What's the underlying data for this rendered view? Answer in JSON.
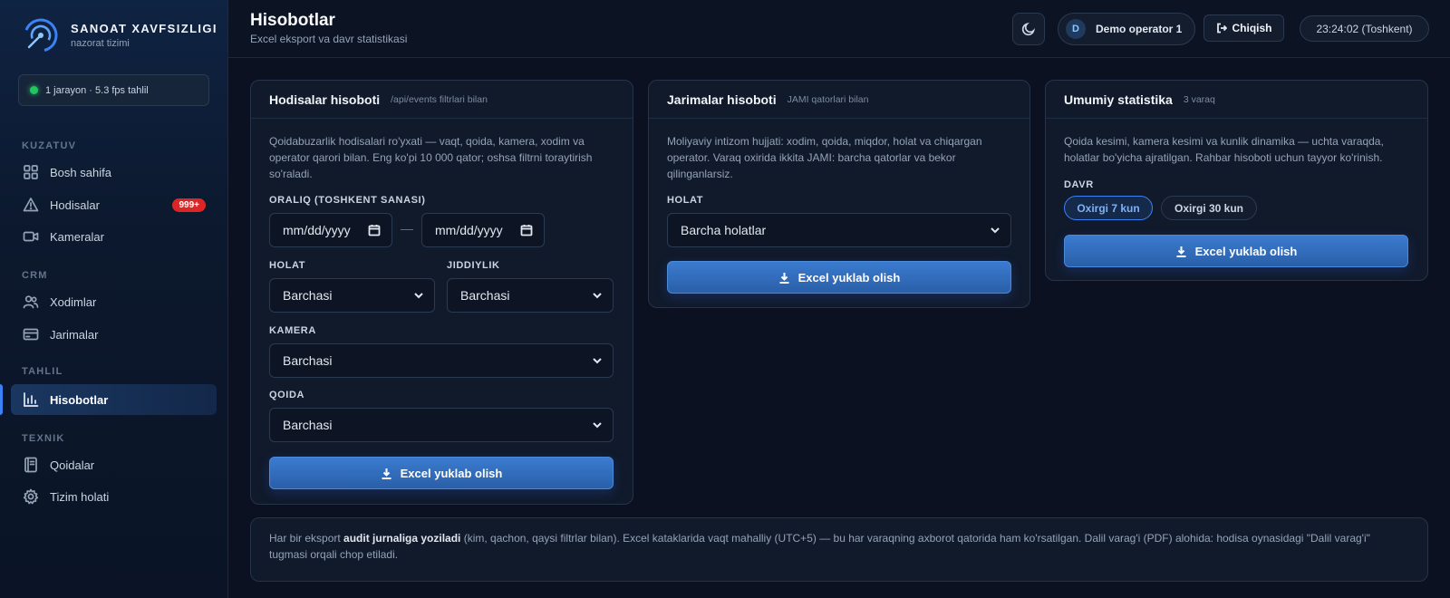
{
  "brand": {
    "title": "SANOAT XAVFSIZLIGI",
    "subtitle": "nazorat tizimi"
  },
  "status": {
    "text": "1 jarayon · 5.3 fps tahlil",
    "color": "#22c55e"
  },
  "nav": {
    "sections": [
      "KUZATUV",
      "CRM",
      "TAHLIL",
      "TEXNIK"
    ],
    "items": [
      {
        "label": "Bosh sahifa",
        "icon": "grid-icon"
      },
      {
        "label": "Hodisalar",
        "icon": "warning-icon",
        "badge": "999+"
      },
      {
        "label": "Kameralar",
        "icon": "camera-icon"
      },
      {
        "label": "Xodimlar",
        "icon": "users-icon"
      },
      {
        "label": "Jarimalar",
        "icon": "card-icon"
      },
      {
        "label": "Hisobotlar",
        "icon": "bar-chart-icon",
        "active": true
      },
      {
        "label": "Qoidalar",
        "icon": "book-icon"
      },
      {
        "label": "Tizim holati",
        "icon": "gear-icon"
      }
    ]
  },
  "header": {
    "title": "Hisobotlar",
    "subtitle": "Excel eksport va davr statistikasi",
    "user_initial": "D",
    "user_name": "Demo operator 1",
    "logout_label": "Chiqish",
    "clock": "23:24:02 (Toshkent)"
  },
  "events_card": {
    "title": "Hodisalar hisoboti",
    "hint": "/api/events filtrlari bilan",
    "desc": "Qoidabuzarlik hodisalari ro'yxati — vaqt, qoida, kamera, xodim va operator qarori bilan. Eng ko'pi 10 000 qator; oshsa filtrni toraytirish so'raladi.",
    "range_label": "ORALIQ (TOSHKENT SANASI)",
    "date_from_placeholder": "mm/dd/yyyy",
    "date_to_placeholder": "mm/dd/yyyy",
    "separator": "—",
    "status_label": "HOLAT",
    "status_value": "Barchasi",
    "severity_label": "JIDDIYLIK",
    "severity_value": "Barchasi",
    "camera_label": "KAMERA",
    "camera_value": "Barchasi",
    "rule_label": "QOIDA",
    "rule_value": "Barchasi",
    "button": "Excel yuklab olish"
  },
  "fines_card": {
    "title": "Jarimalar hisoboti",
    "hint": "JAMI qatorlari bilan",
    "desc": "Moliyaviy intizom hujjati: xodim, qoida, miqdor, holat va chiqargan operator. Varaq oxirida ikkita JAMI: barcha qatorlar va bekor qilinganlarsiz.",
    "status_label": "HOLAT",
    "status_value": "Barcha holatlar",
    "button": "Excel yuklab olish"
  },
  "stats_card": {
    "title": "Umumiy statistika",
    "hint": "3 varaq",
    "desc": "Qoida kesimi, kamera kesimi va kunlik dinamika — uchta varaqda, holatlar bo'yicha ajratilgan. Rahbar hisoboti uchun tayyor ko'rinish.",
    "period_label": "DAVR",
    "period_options": [
      "Oxirgi 7 kun",
      "Oxirgi 30 kun"
    ],
    "period_selected": "Oxirgi 7 kun",
    "button": "Excel yuklab olish"
  },
  "footer": {
    "pre": "Har bir eksport ",
    "bold": "audit jurnaliga yoziladi",
    "post": " (kim, qachon, qaysi filtrlar bilan). Excel kataklarida vaqt mahalliy (UTC+5) — bu har varaqning axborot qatorida ham ko'rsatilgan. Dalil varag'i (PDF) alohida: hodisa oynasidagi \"Dalil varag'i\" tugmasi orqali chop etiladi."
  },
  "colors": {
    "accent": "#3b82f6",
    "badge": "#dc2626",
    "background": "#0b1120"
  }
}
